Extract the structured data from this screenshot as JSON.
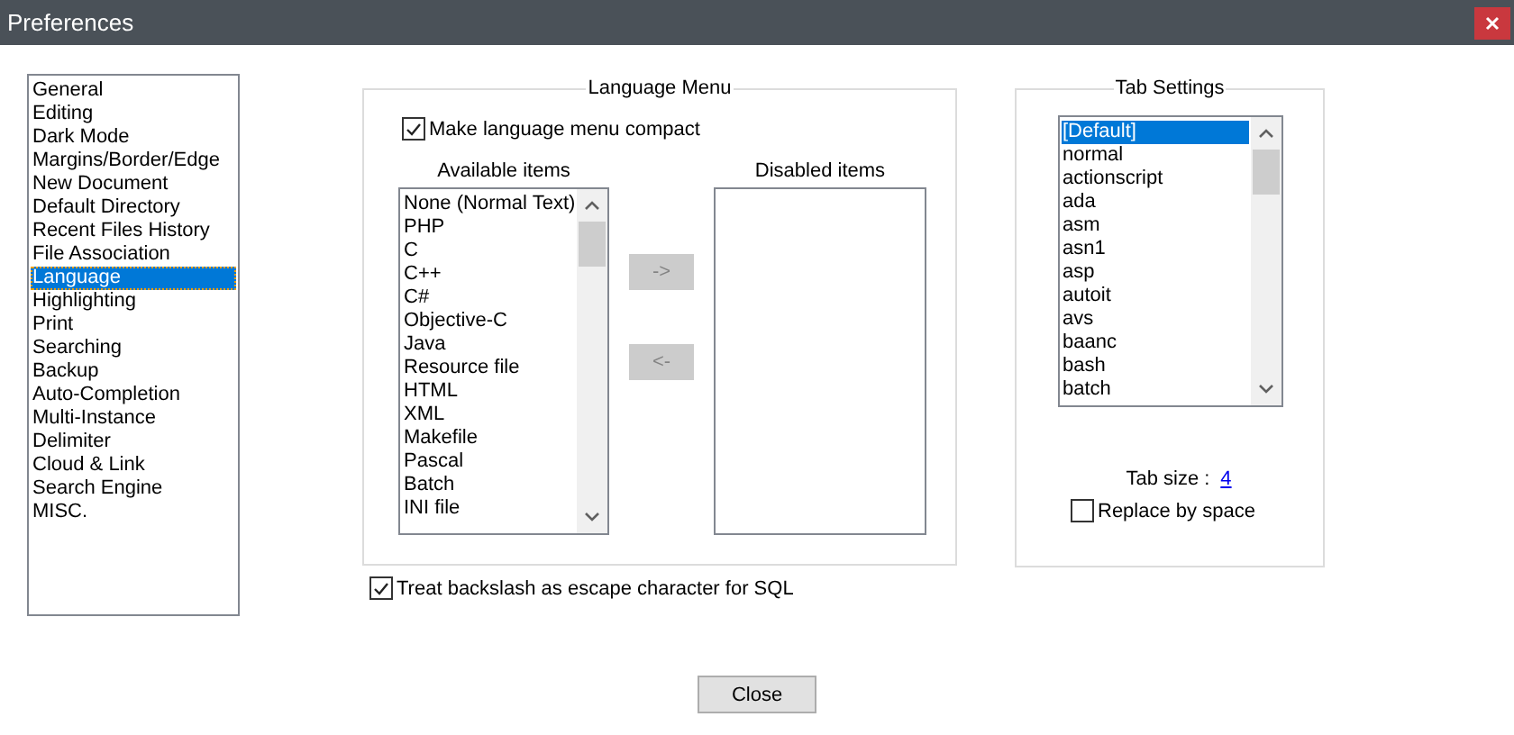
{
  "window": {
    "title": "Preferences"
  },
  "categories": [
    {
      "label": "General",
      "selected": false
    },
    {
      "label": "Editing",
      "selected": false
    },
    {
      "label": "Dark Mode",
      "selected": false
    },
    {
      "label": "Margins/Border/Edge",
      "selected": false
    },
    {
      "label": "New Document",
      "selected": false
    },
    {
      "label": "Default Directory",
      "selected": false
    },
    {
      "label": "Recent Files History",
      "selected": false
    },
    {
      "label": "File Association",
      "selected": false
    },
    {
      "label": "Language",
      "selected": true
    },
    {
      "label": "Highlighting",
      "selected": false
    },
    {
      "label": "Print",
      "selected": false
    },
    {
      "label": "Searching",
      "selected": false
    },
    {
      "label": "Backup",
      "selected": false
    },
    {
      "label": "Auto-Completion",
      "selected": false
    },
    {
      "label": "Multi-Instance",
      "selected": false
    },
    {
      "label": "Delimiter",
      "selected": false
    },
    {
      "label": "Cloud & Link",
      "selected": false
    },
    {
      "label": "Search Engine",
      "selected": false
    },
    {
      "label": "MISC.",
      "selected": false
    }
  ],
  "language_menu": {
    "title": "Language Menu",
    "compact": {
      "label": "Make language menu compact",
      "checked": true
    },
    "available": {
      "heading": "Available items",
      "items": [
        "None (Normal Text)",
        "PHP",
        "C",
        "C++",
        "C#",
        "Objective-C",
        "Java",
        "Resource file",
        "HTML",
        "XML",
        "Makefile",
        "Pascal",
        "Batch",
        "INI file"
      ]
    },
    "disabled": {
      "heading": "Disabled items"
    },
    "buttons": [
      {
        "label": "->",
        "disabled": true
      },
      {
        "label": "<-",
        "disabled": true
      }
    ]
  },
  "sql_option": {
    "label": "Treat backslash as escape character for SQL",
    "checked": true
  },
  "tab_settings": {
    "title": "Tab Settings",
    "languages": [
      {
        "label": "[Default]",
        "selected": true
      },
      {
        "label": "normal",
        "selected": false
      },
      {
        "label": "actionscript",
        "selected": false
      },
      {
        "label": "ada",
        "selected": false
      },
      {
        "label": "asm",
        "selected": false
      },
      {
        "label": "asn1",
        "selected": false
      },
      {
        "label": "asp",
        "selected": false
      },
      {
        "label": "autoit",
        "selected": false
      },
      {
        "label": "avs",
        "selected": false
      },
      {
        "label": "baanc",
        "selected": false
      },
      {
        "label": "bash",
        "selected": false
      },
      {
        "label": "batch",
        "selected": false
      }
    ],
    "tab_size_label": "Tab size :",
    "tab_size": "4",
    "replace": {
      "label": "Replace by space",
      "checked": false
    }
  },
  "close_button": "Close"
}
